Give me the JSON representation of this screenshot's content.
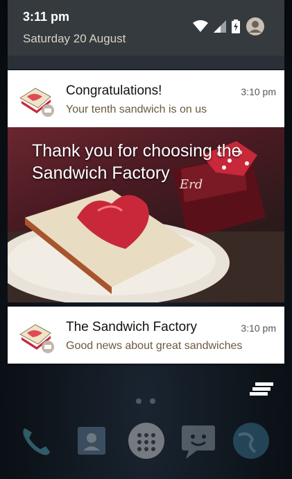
{
  "status_bar": {
    "time": "3:11 pm",
    "date": "Saturday 20 August"
  },
  "notifications": [
    {
      "title": "Congratulations!",
      "text": "Your tenth sandwich is on us",
      "time": "3:10 pm",
      "big_picture_caption": "Thank you for choosing the Sandwich Factory"
    },
    {
      "title": "The Sandwich Factory",
      "text": "Good news about great sandwiches",
      "time": "3:10 pm"
    }
  ],
  "jar_label": "Erd",
  "colors": {
    "shade_header": "#353a3e",
    "card_background": "#ffffff",
    "notification_text": "#6b5a3e",
    "picture_red": "#c8283a"
  },
  "icons": {
    "wifi": "wifi-icon",
    "signal": "cell-signal-icon",
    "battery": "battery-charging-icon",
    "user": "user-avatar-icon",
    "app": "sandwich-app-icon",
    "clear_all": "clear-all-icon",
    "dock": [
      "phone-icon",
      "contacts-icon",
      "app-drawer-icon",
      "messaging-icon",
      "browser-icon"
    ]
  }
}
